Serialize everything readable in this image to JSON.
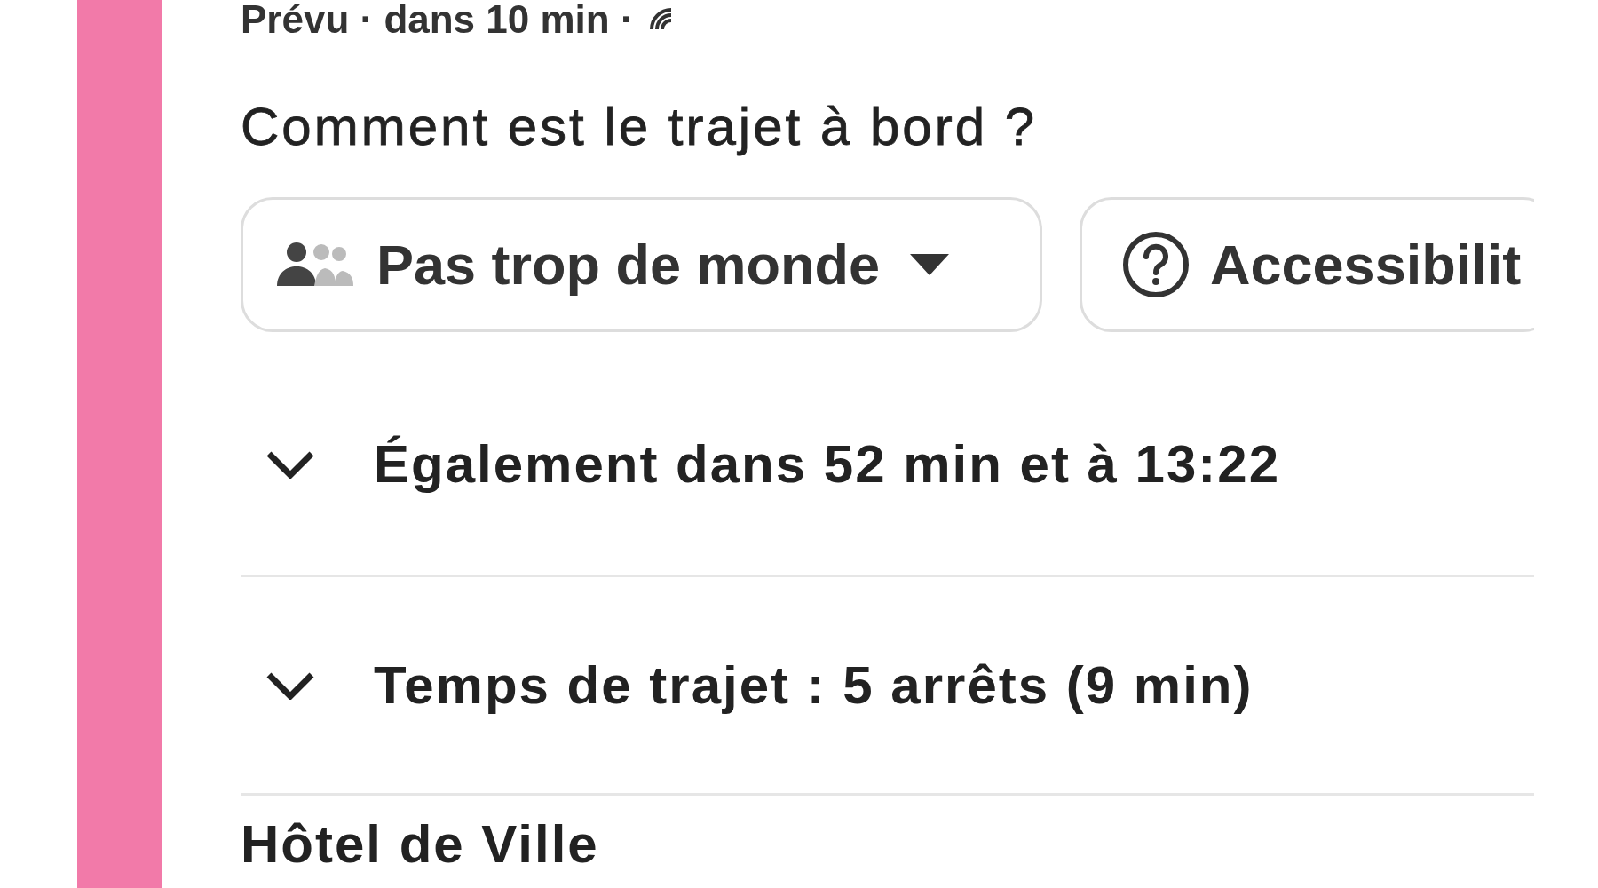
{
  "status_line": "Prévu · dans 10 min ·",
  "question": "Comment est le trajet à bord ?",
  "chips": [
    {
      "kind": "dropdown",
      "label": "Pas trop de monde"
    },
    {
      "kind": "help",
      "label": "Accessibilit"
    }
  ],
  "expanders": [
    {
      "label": "Également dans 52 min et à 13:22",
      "expanded": false
    },
    {
      "label": "Temps de trajet : 5 arrêts (9 min)",
      "expanded": false
    }
  ],
  "next_stop": "Hôtel de Ville"
}
